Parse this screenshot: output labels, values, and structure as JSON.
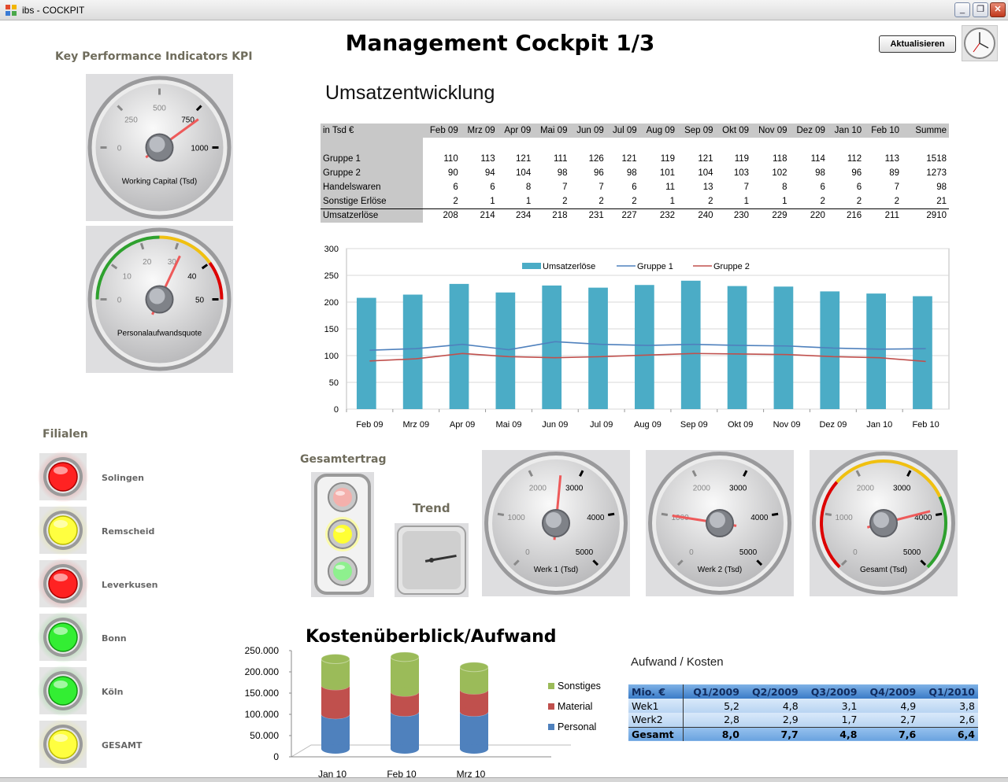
{
  "window": {
    "title": "ibs - COCKPIT"
  },
  "header": {
    "title": "Management Cockpit 1/3",
    "refresh_label": "Aktualisieren"
  },
  "kpi": {
    "heading": "Key Performance Indicators KPI",
    "working_capital": {
      "label": "Working Capital (Tsd)",
      "ticks": [
        "0",
        "250",
        "500",
        "750",
        "1000"
      ],
      "min": 0,
      "max": 1000,
      "value": 800
    },
    "personal_quote": {
      "label": "Personalaufwandsquote",
      "ticks": [
        "0",
        "10",
        "20",
        "30",
        "40",
        "50"
      ],
      "min": 0,
      "max": 50,
      "value": 32
    }
  },
  "sales": {
    "heading": "Umsatzentwicklung",
    "table": {
      "header_label": "in Tsd €",
      "columns": [
        "Feb 09",
        "Mrz 09",
        "Apr 09",
        "Mai 09",
        "Jun 09",
        "Jul 09",
        "Aug 09",
        "Sep 09",
        "Okt 09",
        "Nov 09",
        "Dez 09",
        "Jan 10",
        "Feb 10",
        "Summe"
      ],
      "rows": [
        {
          "label": "Gruppe 1",
          "values": [
            "110",
            "113",
            "121",
            "111",
            "126",
            "121",
            "119",
            "121",
            "119",
            "118",
            "114",
            "112",
            "113",
            "1518"
          ]
        },
        {
          "label": "Gruppe 2",
          "values": [
            "90",
            "94",
            "104",
            "98",
            "96",
            "98",
            "101",
            "104",
            "103",
            "102",
            "98",
            "96",
            "89",
            "1273"
          ]
        },
        {
          "label": "Handelswaren",
          "values": [
            "6",
            "6",
            "8",
            "7",
            "7",
            "6",
            "11",
            "13",
            "7",
            "8",
            "6",
            "6",
            "7",
            "98"
          ]
        },
        {
          "label": "Sonstige Erlöse",
          "values": [
            "2",
            "1",
            "1",
            "2",
            "2",
            "2",
            "1",
            "2",
            "1",
            "1",
            "2",
            "2",
            "2",
            "21"
          ]
        }
      ],
      "total": {
        "label": "Umsatzerlöse",
        "values": [
          "208",
          "214",
          "234",
          "218",
          "231",
          "227",
          "232",
          "240",
          "230",
          "229",
          "220",
          "216",
          "211",
          "2910"
        ]
      }
    }
  },
  "chart_data": [
    {
      "type": "bar",
      "categories": [
        "Feb 09",
        "Mrz 09",
        "Apr 09",
        "Mai 09",
        "Jun 09",
        "Jul 09",
        "Aug 09",
        "Sep 09",
        "Okt 09",
        "Nov 09",
        "Dez 09",
        "Jan 10",
        "Feb 10"
      ],
      "series": [
        {
          "name": "Umsatzerlöse",
          "kind": "bar",
          "color": "#4bacc6",
          "values": [
            208,
            214,
            234,
            218,
            231,
            227,
            232,
            240,
            230,
            229,
            220,
            216,
            211
          ]
        },
        {
          "name": "Gruppe 1",
          "kind": "line",
          "color": "#4f81bd",
          "values": [
            110,
            113,
            121,
            111,
            126,
            121,
            119,
            121,
            119,
            118,
            114,
            112,
            113
          ]
        },
        {
          "name": "Gruppe 2",
          "kind": "line",
          "color": "#c0504d",
          "values": [
            90,
            94,
            104,
            98,
            96,
            98,
            101,
            104,
            103,
            102,
            98,
            96,
            89
          ]
        }
      ],
      "ylim": [
        0,
        300
      ],
      "yticks": [
        "0",
        "50",
        "100",
        "150",
        "200",
        "250",
        "300"
      ],
      "legend": "top-center",
      "grid": true
    },
    {
      "type": "bar",
      "stacked": true,
      "title": "Kostenüberblick/Aufwand",
      "categories": [
        "Jan 10",
        "Feb 10",
        "Mrz 10"
      ],
      "series": [
        {
          "name": "Personal",
          "color": "#4f81bd",
          "values": [
            82000,
            88000,
            88000
          ]
        },
        {
          "name": "Material",
          "color": "#c0504d",
          "values": [
            68000,
            47000,
            52000
          ]
        },
        {
          "name": "Sonstiges",
          "color": "#9bbb59",
          "values": [
            62000,
            82000,
            53000
          ]
        }
      ],
      "ylim": [
        0,
        250000
      ],
      "yticks": [
        "0",
        "50.000",
        "100.000",
        "150.000",
        "200.000",
        "250.000"
      ],
      "legend": "right"
    }
  ],
  "branches": {
    "heading": "Filialen",
    "items": [
      {
        "name": "Solingen",
        "status": "red"
      },
      {
        "name": "Remscheid",
        "status": "yellow"
      },
      {
        "name": "Leverkusen",
        "status": "red"
      },
      {
        "name": "Bonn",
        "status": "green"
      },
      {
        "name": "Köln",
        "status": "green"
      },
      {
        "name": "GESAMT",
        "status": "yellow"
      }
    ]
  },
  "revenue": {
    "heading": "Gesamtertrag",
    "status": "yellow",
    "trend_heading": "Trend",
    "trend_angle_deg": -10
  },
  "plants": [
    {
      "label": "Werk 1 (Tsd)",
      "ticks": [
        "0",
        "1000",
        "2000",
        "3000",
        "4000",
        "5000"
      ],
      "min": 0,
      "max": 5000,
      "value": 2600,
      "colored": false
    },
    {
      "label": "Werk 2 (Tsd)",
      "ticks": [
        "0",
        "1000",
        "2000",
        "3000",
        "4000",
        "5000"
      ],
      "min": 0,
      "max": 5000,
      "value": 1000,
      "colored": false
    },
    {
      "label": "Gesamt (Tsd)",
      "ticks": [
        "0",
        "1000",
        "2000",
        "3000",
        "4000",
        "5000"
      ],
      "min": 0,
      "max": 5000,
      "value": 3900,
      "colored": true
    }
  ],
  "expenses": {
    "heading": "Aufwand / Kosten",
    "header": [
      "Mio. €",
      "Q1/2009",
      "Q2/2009",
      "Q3/2009",
      "Q4/2009",
      "Q1/2010"
    ],
    "rows": [
      [
        "Wek1",
        "5,2",
        "4,8",
        "3,1",
        "4,9",
        "3,8"
      ],
      [
        "Werk2",
        "2,8",
        "2,9",
        "1,7",
        "2,7",
        "2,6"
      ]
    ],
    "total": [
      "Gesamt",
      "8,0",
      "7,7",
      "4,8",
      "7,6",
      "6,4"
    ]
  }
}
